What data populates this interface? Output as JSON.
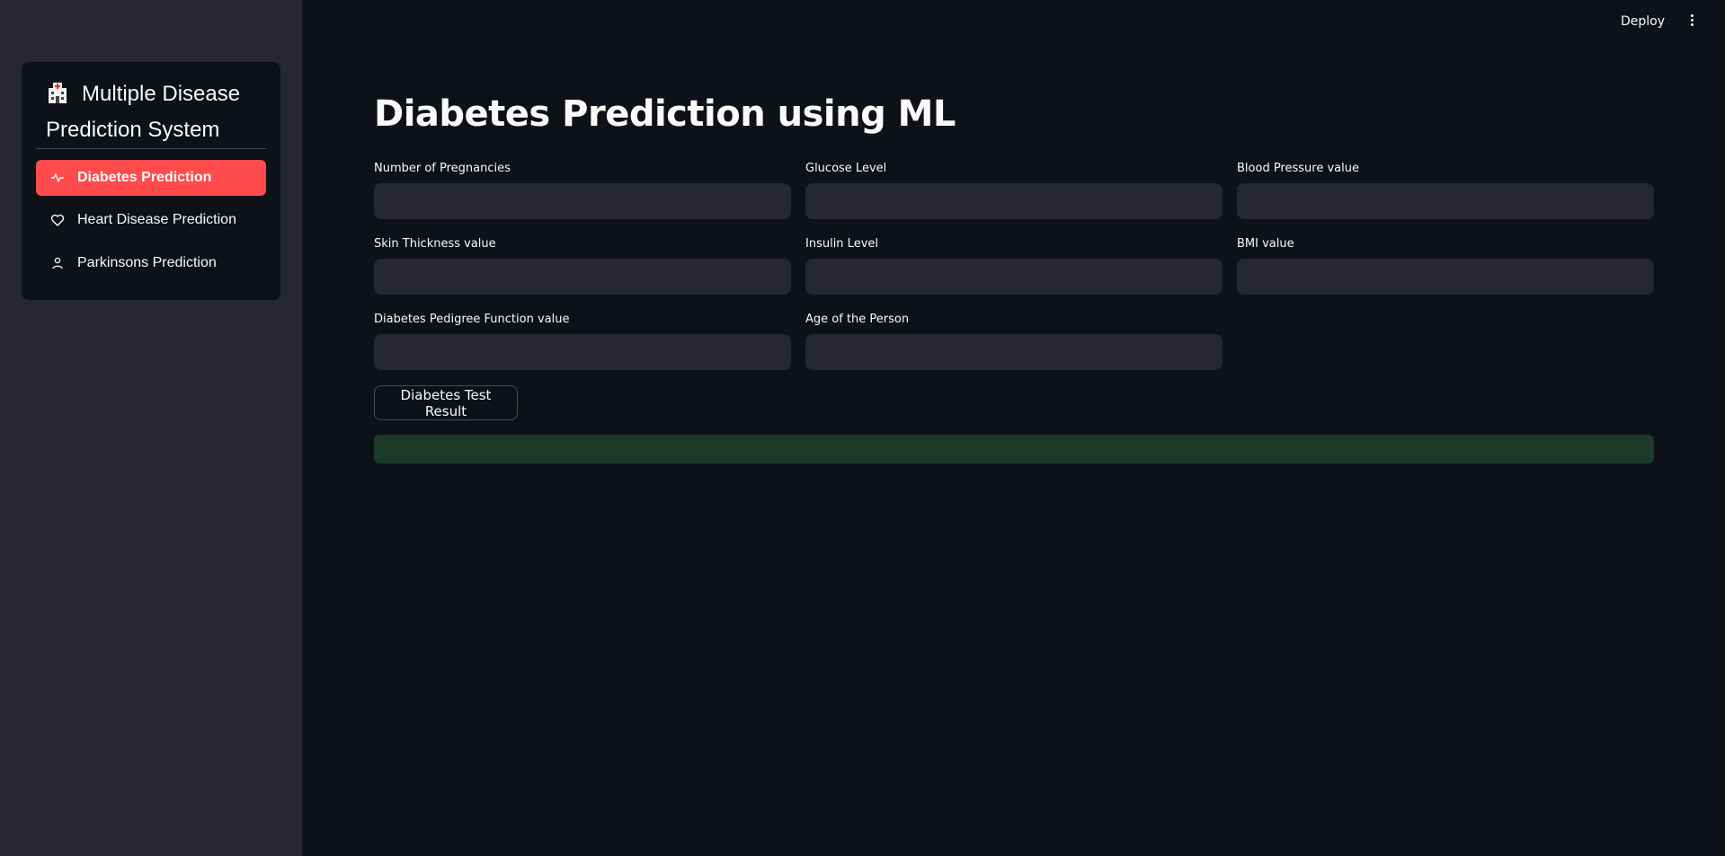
{
  "sidebar": {
    "menu_title": "Multiple Disease Prediction System",
    "items": [
      {
        "label": "Diabetes Prediction",
        "icon": "activity-icon",
        "active": true
      },
      {
        "label": "Heart Disease Prediction",
        "icon": "heart-icon",
        "active": false
      },
      {
        "label": "Parkinsons Prediction",
        "icon": "person-icon",
        "active": false
      }
    ],
    "active_color": "#ff4b4b"
  },
  "topbar": {
    "deploy_label": "Deploy",
    "menu_icon": "more-vertical-icon"
  },
  "main": {
    "title": "Diabetes Prediction using ML",
    "fields": [
      {
        "label": "Number of Pregnancies",
        "value": ""
      },
      {
        "label": "Glucose Level",
        "value": ""
      },
      {
        "label": "Blood Pressure value",
        "value": ""
      },
      {
        "label": "Skin Thickness value",
        "value": ""
      },
      {
        "label": "Insulin Level",
        "value": ""
      },
      {
        "label": "BMI value",
        "value": ""
      },
      {
        "label": "Diabetes Pedigree Function value",
        "value": ""
      },
      {
        "label": "Age of the Person",
        "value": ""
      }
    ],
    "button_label": "Diabetes Test Result",
    "result_text": "",
    "result_color": "#1b3a29"
  }
}
